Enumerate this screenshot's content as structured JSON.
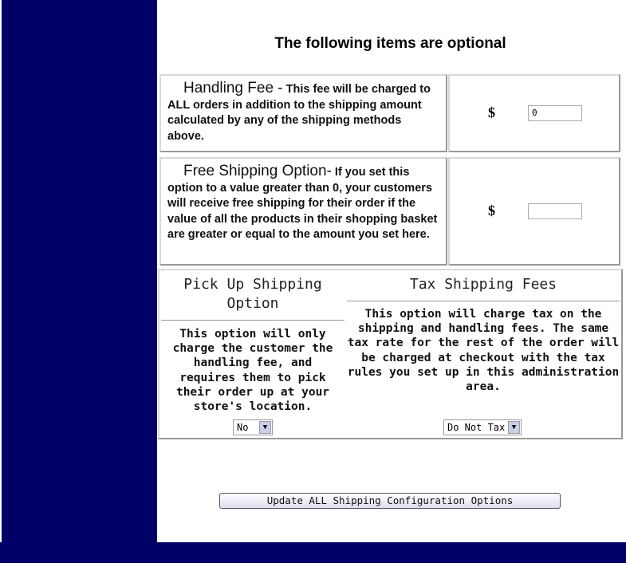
{
  "title": "The following items are optional",
  "handling_fee": {
    "label": "Handling Fee -",
    "description": "This fee will be charged to ALL orders in addition to the shipping amount calculated by any of the shipping methods above.",
    "currency": "$",
    "value": "0"
  },
  "free_shipping": {
    "label": "Free Shipping Option-",
    "description": "If you set this option to a value greater than 0, your customers will receive free shipping for their order if the value of all the products in their shopping basket are greater or equal to the amount you set here.",
    "currency": "$",
    "value": ""
  },
  "pickup": {
    "heading": "Pick Up Shipping Option",
    "description": "This option will only charge the customer the handling fee, and requires them to pick their order up at your store's location.",
    "selected": "No"
  },
  "tax": {
    "heading": "Tax Shipping Fees",
    "description": "This option will charge tax on the shipping and handling fees. The same tax rate for the rest of the order will be charged at checkout with the tax rules you set up in this administration area.",
    "selected": "Do Not Tax"
  },
  "update_button": "Update ALL Shipping Configuration Options",
  "colors": {
    "sidebar": "#000066",
    "content": "#ffffff"
  }
}
